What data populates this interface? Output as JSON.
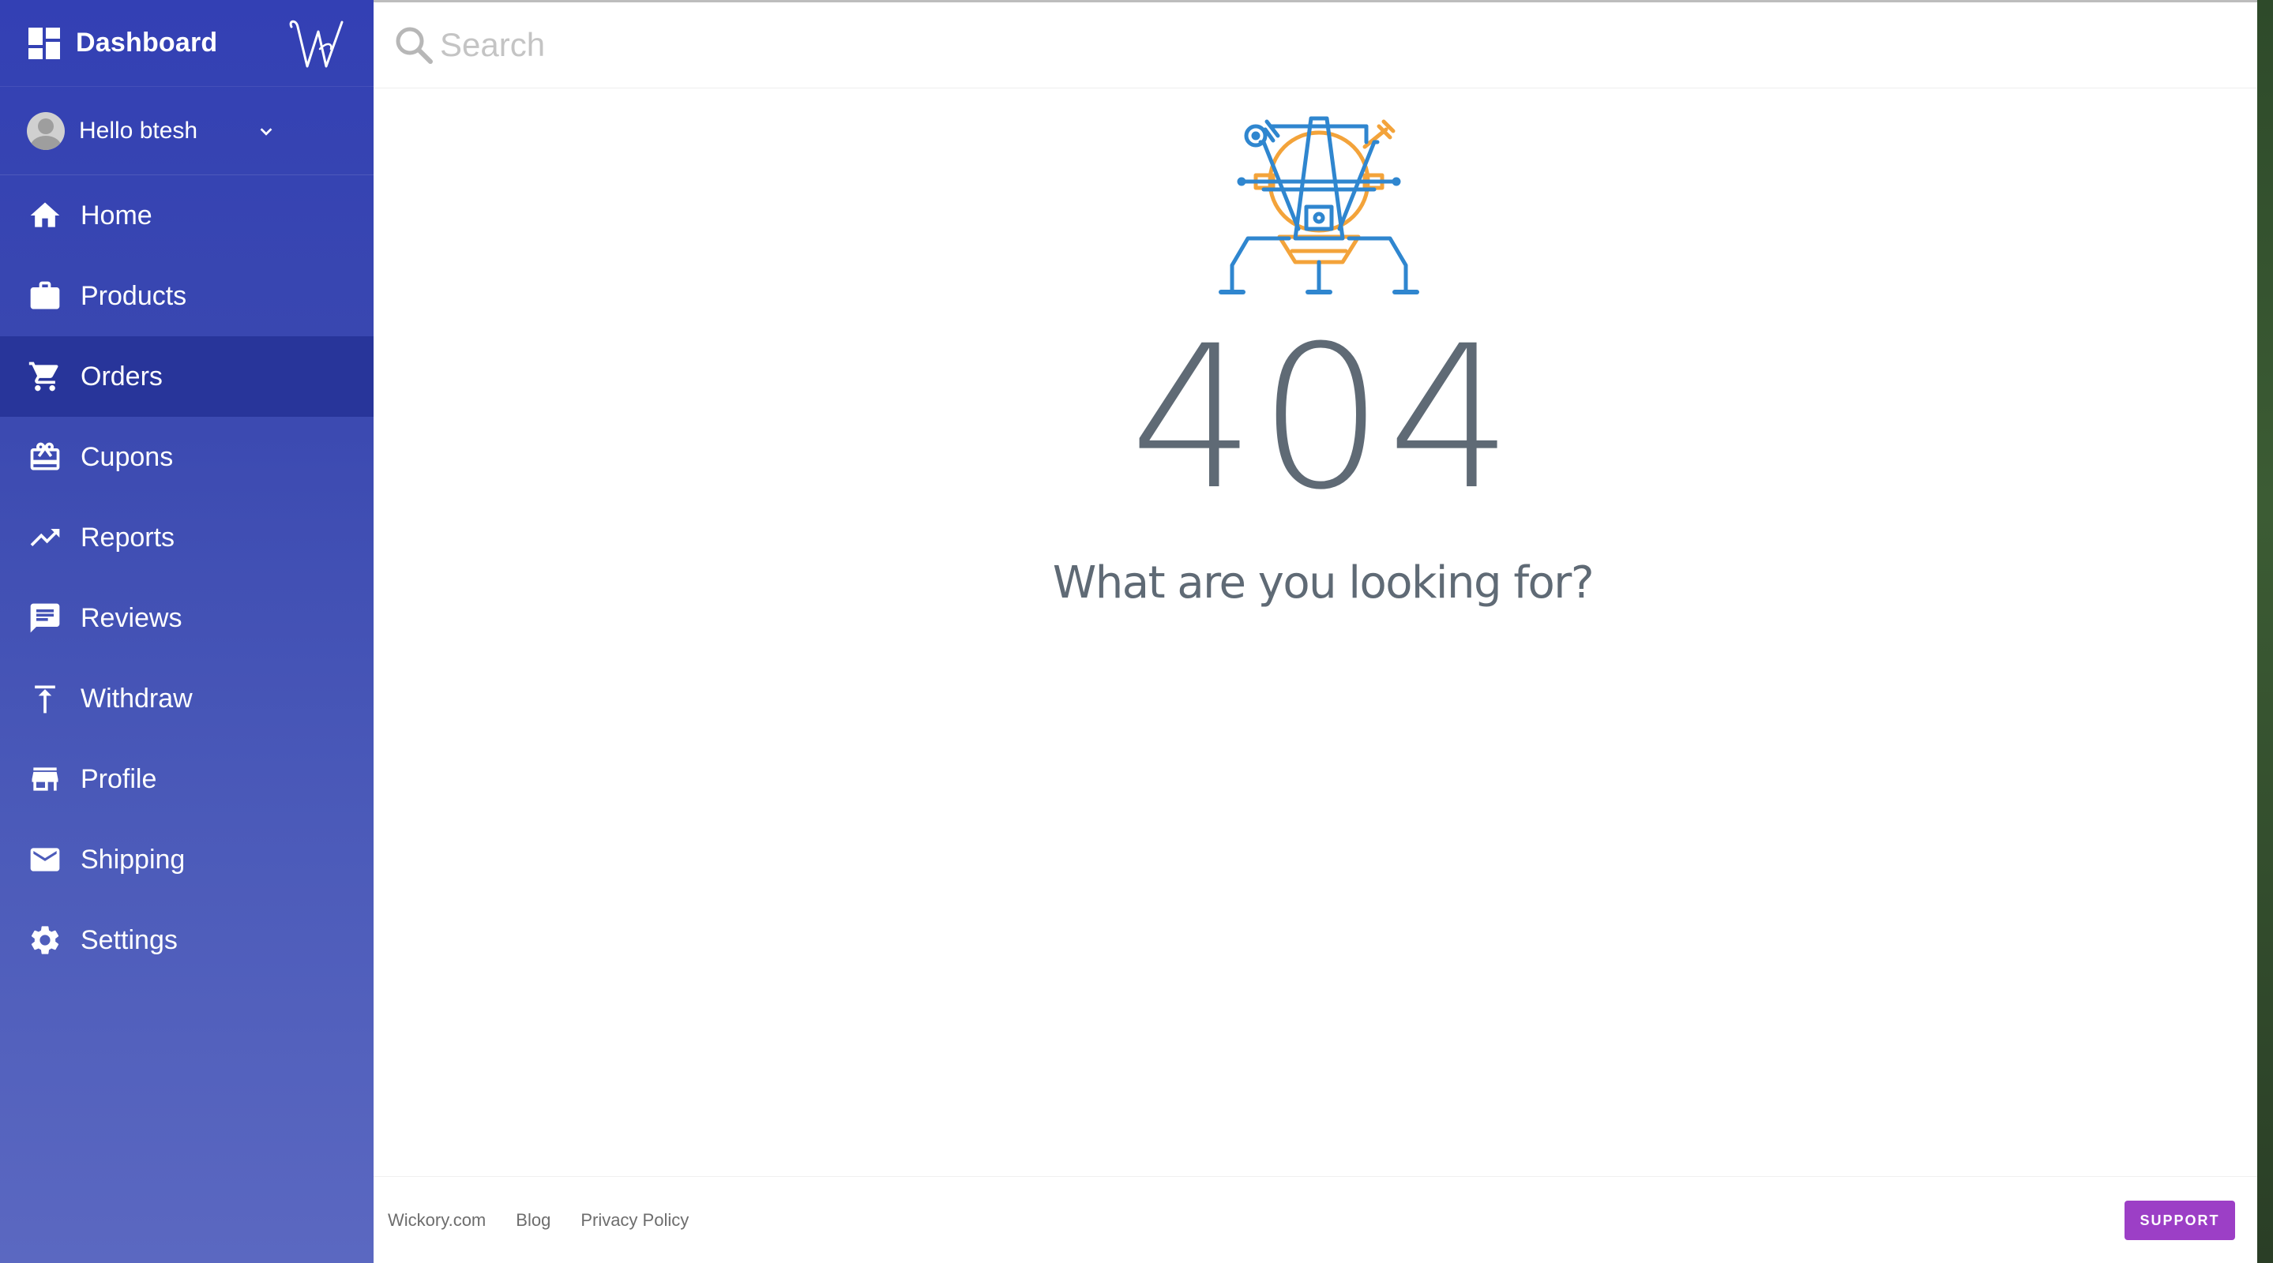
{
  "sidebar": {
    "title": "Dashboard",
    "user_greeting": "Hello btesh",
    "active_item": "Orders",
    "items": [
      {
        "label": "Home",
        "icon": "home-icon"
      },
      {
        "label": "Products",
        "icon": "briefcase-icon"
      },
      {
        "label": "Orders",
        "icon": "cart-icon"
      },
      {
        "label": "Cupons",
        "icon": "gift-card-icon"
      },
      {
        "label": "Reports",
        "icon": "trending-up-icon"
      },
      {
        "label": "Reviews",
        "icon": "comment-icon"
      },
      {
        "label": "Withdraw",
        "icon": "upload-arrow-icon"
      },
      {
        "label": "Profile",
        "icon": "store-icon"
      },
      {
        "label": "Shipping",
        "icon": "mail-icon"
      },
      {
        "label": "Settings",
        "icon": "gear-icon"
      }
    ]
  },
  "search": {
    "placeholder": "Search",
    "value": ""
  },
  "error": {
    "code": "404",
    "message": "What are you looking for?"
  },
  "footer": {
    "links": [
      "Wickory.com",
      "Blog",
      "Privacy Policy"
    ],
    "support_label": "SUPPORT"
  },
  "colors": {
    "sidebar_top": "#3340b4",
    "sidebar_bottom": "#5b68c1",
    "active_item": "#28359a",
    "support_button": "#9c3fc6",
    "text_gray": "#5f6a75",
    "illustration_blue": "#2f86cf",
    "illustration_orange": "#f3a33a"
  }
}
